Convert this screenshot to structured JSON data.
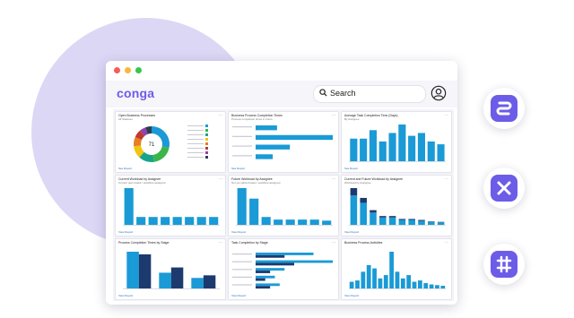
{
  "app": {
    "logo_text": "conga",
    "search_label": "Search",
    "brand_color": "#6c5ce7",
    "chart_color": "#1a9ad6"
  },
  "icons": {
    "search": "search-icon",
    "user": "user-icon",
    "side": [
      "link-icon",
      "close-x-icon",
      "grid-lines-icon"
    ]
  },
  "panels": [
    {
      "title": "Open Business Processes",
      "subtitle": "All Statuses",
      "link": "See Report",
      "chart_data": {
        "type": "pie",
        "center_label": "71",
        "values": [
          20,
          14,
          10,
          8,
          6,
          5,
          4,
          4
        ],
        "colors": [
          "#1a9ad6",
          "#3cb54a",
          "#17a589",
          "#f1c40f",
          "#e67e22",
          "#c0392b",
          "#8e44ad",
          "#2c3e50"
        ]
      }
    },
    {
      "title": "Business Process Completion Times",
      "subtitle": "Process completion times in hours",
      "link": "See Report",
      "chart_data": {
        "type": "bar",
        "orientation": "horizontal",
        "values": [
          25,
          90,
          40,
          20
        ]
      }
    },
    {
      "title": "Average Task Completion Time (Days)",
      "subtitle": "By Assignee",
      "link": "See Report",
      "chart_data": {
        "type": "bar",
        "values": [
          40,
          40,
          55,
          35,
          50,
          65,
          45,
          50,
          35,
          30
        ]
      }
    },
    {
      "title": "Current Workload by Assignee",
      "subtitle": "Current open tasks / workflow assigned",
      "link": "View Report",
      "chart_data": {
        "type": "bar",
        "values": [
          70,
          15,
          15,
          15,
          15,
          15,
          15,
          15
        ]
      }
    },
    {
      "title": "Future Workload by Assignee",
      "subtitle": "Not yet started tasks / workflow assigned",
      "link": "View Report",
      "chart_data": {
        "type": "bar",
        "values": [
          70,
          50,
          15,
          10,
          10,
          10,
          10,
          8
        ]
      }
    },
    {
      "title": "Current and Future Workload by Assignee",
      "subtitle": "Workload by Assignee",
      "link": "View Report",
      "chart_data": {
        "type": "bar",
        "stacked": true,
        "series": [
          {
            "values": [
              60,
              45,
              25,
              15,
              15,
              10,
              10,
              8,
              6,
              5
            ]
          },
          {
            "values": [
              15,
              10,
              5,
              3,
              3,
              2,
              2,
              2,
              1,
              1
            ]
          }
        ]
      }
    },
    {
      "title": "Process Completion Times by Stage",
      "subtitle": "",
      "link": "View Report",
      "chart_data": {
        "type": "bar",
        "series": [
          {
            "values": [
              70,
              30,
              20
            ]
          },
          {
            "values": [
              65,
              40,
              25
            ]
          }
        ]
      }
    },
    {
      "title": "Task Completion by Stage",
      "subtitle": "",
      "link": "View Report",
      "chart_data": {
        "type": "bar",
        "orientation": "horizontal",
        "series": [
          {
            "values": [
              60,
              80,
              30,
              20,
              25
            ]
          },
          {
            "values": [
              30,
              40,
              15,
              10,
              15
            ]
          }
        ]
      }
    },
    {
      "title": "Business Process Activities",
      "subtitle": "",
      "link": "View Report",
      "chart_data": {
        "type": "bar",
        "values": [
          10,
          12,
          25,
          35,
          30,
          15,
          20,
          55,
          25,
          15,
          20,
          10,
          12,
          8,
          6,
          5,
          4
        ]
      }
    }
  ]
}
